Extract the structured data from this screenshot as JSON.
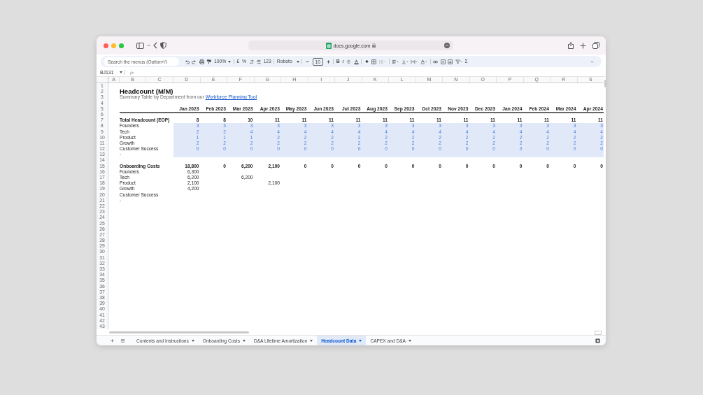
{
  "browser": {
    "url": "docs.google.com"
  },
  "toolbar": {
    "search_placeholder": "Search the menus (Option+/)",
    "zoom": "100%",
    "currency": "£",
    "percent": "%",
    "number_format": "123",
    "font": "Roboto",
    "font_size": "10",
    "bold": "B",
    "italic": "I",
    "sum": "Σ"
  },
  "formula_bar": {
    "cell": "BJ131",
    "fx": "fx"
  },
  "columns": [
    "A",
    "B",
    "C",
    "D",
    "E",
    "F",
    "G",
    "H",
    "I",
    "J",
    "K",
    "L",
    "M",
    "N",
    "O",
    "P",
    "Q",
    "R",
    "S"
  ],
  "rows": [
    {
      "number": "1"
    },
    {
      "number": "2",
      "kind": "title",
      "label": "Headcount (M/M)"
    },
    {
      "number": "3",
      "kind": "subtitle",
      "label": "Summary Table by Department from our",
      "link": "Workforce Planning Tool"
    },
    {
      "number": "4"
    },
    {
      "number": "5",
      "kind": "header",
      "highlighted": false,
      "values": [
        "Jan 2023",
        "Feb 2023",
        "Mar 2023",
        "Apr 2023",
        "May 2023",
        "Jun 2023",
        "Jul 2023",
        "Aug 2023",
        "Sep 2023",
        "Oct 2023",
        "Nov 2023",
        "Dec 2023",
        "Jan 2024",
        "Feb 2024",
        "Mar 2024",
        "Apr 2024"
      ]
    },
    {
      "number": "6"
    },
    {
      "number": "7",
      "kind": "total",
      "highlighted": false,
      "label": "Total Headcount (EOP)",
      "values": [
        "8",
        "8",
        "10",
        "11",
        "11",
        "11",
        "11",
        "11",
        "11",
        "11",
        "11",
        "11",
        "11",
        "11",
        "11",
        "11"
      ]
    },
    {
      "number": "8",
      "kind": "input",
      "highlighted": true,
      "label": "Founders",
      "values": [
        "3",
        "3",
        "3",
        "3",
        "3",
        "3",
        "3",
        "3",
        "3",
        "3",
        "3",
        "3",
        "3",
        "3",
        "3",
        "3"
      ]
    },
    {
      "number": "9",
      "kind": "input",
      "highlighted": true,
      "label": "Tech",
      "values": [
        "2",
        "2",
        "4",
        "4",
        "4",
        "4",
        "4",
        "4",
        "4",
        "4",
        "4",
        "4",
        "4",
        "4",
        "4",
        "4"
      ]
    },
    {
      "number": "10",
      "kind": "input",
      "highlighted": true,
      "label": "Product",
      "values": [
        "1",
        "1",
        "1",
        "2",
        "2",
        "2",
        "2",
        "2",
        "2",
        "2",
        "2",
        "2",
        "2",
        "2",
        "2",
        "2"
      ]
    },
    {
      "number": "11",
      "kind": "input",
      "highlighted": true,
      "label": "Growth",
      "values": [
        "2",
        "2",
        "2",
        "2",
        "2",
        "2",
        "2",
        "2",
        "2",
        "2",
        "2",
        "2",
        "2",
        "2",
        "2",
        "2"
      ]
    },
    {
      "number": "12",
      "kind": "input",
      "highlighted": true,
      "label": "Customer Success",
      "values": [
        "0",
        "0",
        "0",
        "0",
        "0",
        "0",
        "0",
        "0",
        "0",
        "0",
        "0",
        "0",
        "0",
        "0",
        "0",
        "0"
      ]
    },
    {
      "number": "13",
      "kind": "item",
      "highlighted": true,
      "label": "-"
    },
    {
      "number": "14"
    },
    {
      "number": "15",
      "kind": "total",
      "highlighted": false,
      "label": "Onboarding Costs",
      "values": [
        "18,800",
        "0",
        "6,200",
        "2,100",
        "0",
        "0",
        "0",
        "0",
        "0",
        "0",
        "0",
        "0",
        "0",
        "0",
        "0",
        "0"
      ]
    },
    {
      "number": "16",
      "kind": "item",
      "highlighted": false,
      "label": "Founders",
      "cells": {
        "D": "6,300"
      }
    },
    {
      "number": "17",
      "kind": "item",
      "highlighted": false,
      "label": "Tech",
      "cells": {
        "D": "6,200",
        "F": "6,200"
      }
    },
    {
      "number": "18",
      "kind": "item",
      "highlighted": false,
      "label": "Product",
      "cells": {
        "D": "2,100",
        "G": "2,100"
      }
    },
    {
      "number": "19",
      "kind": "item",
      "highlighted": false,
      "label": "Growth",
      "cells": {
        "D": "4,200"
      }
    },
    {
      "number": "20",
      "kind": "item",
      "highlighted": false,
      "label": "Customer Success"
    },
    {
      "number": "21",
      "kind": "item",
      "highlighted": false,
      "label": "-"
    },
    {
      "number": "22"
    },
    {
      "number": "23"
    },
    {
      "number": "24"
    },
    {
      "number": "25"
    },
    {
      "number": "26"
    },
    {
      "number": "27"
    },
    {
      "number": "28"
    },
    {
      "number": "29"
    },
    {
      "number": "30"
    },
    {
      "number": "31"
    },
    {
      "number": "32"
    },
    {
      "number": "33"
    },
    {
      "number": "34"
    },
    {
      "number": "35"
    },
    {
      "number": "36"
    },
    {
      "number": "37"
    },
    {
      "number": "38"
    },
    {
      "number": "39"
    },
    {
      "number": "40"
    },
    {
      "number": "41"
    },
    {
      "number": "42"
    },
    {
      "number": "43"
    }
  ],
  "sheet_tabs": [
    {
      "label": "Contents and Instructions",
      "selected": false
    },
    {
      "label": "Onboarding Costs",
      "selected": false
    },
    {
      "label": "D&A Lifetime Amortization",
      "selected": false
    },
    {
      "label": "Headcount Data",
      "selected": true
    },
    {
      "label": "CAPEX and D&A",
      "selected": false
    }
  ]
}
